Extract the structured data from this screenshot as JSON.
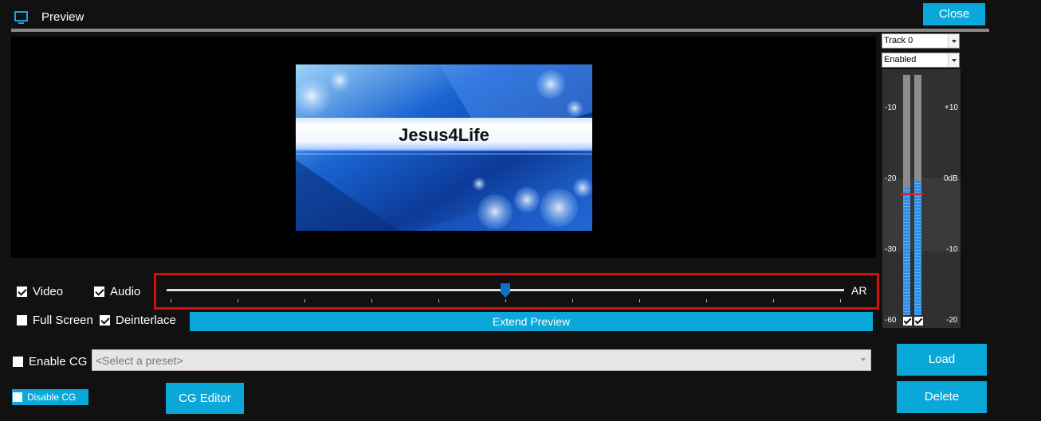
{
  "window": {
    "title": "Preview",
    "close_label": "Close"
  },
  "preview": {
    "overlay_text": "Jesus4Life"
  },
  "options": {
    "video": {
      "label": "Video",
      "checked": true
    },
    "audio": {
      "label": "Audio",
      "checked": true
    },
    "full_screen": {
      "label": "Full Screen",
      "checked": false
    },
    "deinterlace": {
      "label": "Deinterlace",
      "checked": true
    }
  },
  "slider": {
    "end_label": "AR",
    "value_fraction": 0.5,
    "tick_count": 11
  },
  "extend_preview_label": "Extend Preview",
  "cg": {
    "enable_label": "Enable CG",
    "enable_checked": false,
    "preset_placeholder": "<Select a preset>",
    "disable_label": "Disable CG",
    "editor_label": "CG Editor",
    "load_label": "Load",
    "delete_label": "Delete"
  },
  "audio_meter": {
    "track_select": "Track 0",
    "status_select": "Enabled",
    "left_scale": [
      "-10",
      "-20",
      "-30",
      "-60"
    ],
    "right_scale": [
      "+10",
      "0dB",
      "-10",
      "-20"
    ],
    "left_level_fraction": 0.53,
    "right_level_fraction": 0.56
  },
  "colors": {
    "accent": "#09a8d8",
    "highlight": "#d40f0f",
    "meter_fill": "#2f8fe6"
  }
}
